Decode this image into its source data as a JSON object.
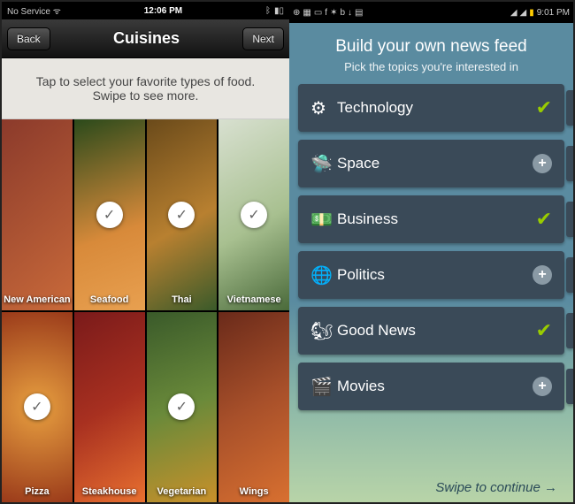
{
  "left": {
    "statusbar": {
      "carrier": "No Service",
      "time": "12:06 PM"
    },
    "header": {
      "back": "Back",
      "title": "Cuisines",
      "next": "Next"
    },
    "instructions": {
      "line1": "Tap to select your favorite types of food.",
      "line2": "Swipe to see more."
    },
    "tiles": [
      {
        "label": "New American",
        "selected": false
      },
      {
        "label": "Seafood",
        "selected": true
      },
      {
        "label": "Thai",
        "selected": true
      },
      {
        "label": "Vietnamese",
        "selected": true
      },
      {
        "label": "Pizza",
        "selected": true
      },
      {
        "label": "Steakhouse",
        "selected": false
      },
      {
        "label": "Vegetarian",
        "selected": true
      },
      {
        "label": "Wings",
        "selected": false
      }
    ]
  },
  "right": {
    "statusbar": {
      "time": "9:01 PM"
    },
    "header": {
      "title": "Build your own news feed",
      "subtitle": "Pick the topics you're interested in"
    },
    "topics": [
      {
        "icon": "gears",
        "label": "Technology",
        "selected": true
      },
      {
        "icon": "ufo",
        "label": "Space",
        "selected": false
      },
      {
        "icon": "money",
        "label": "Business",
        "selected": true
      },
      {
        "icon": "globe",
        "label": "Politics",
        "selected": false
      },
      {
        "icon": "animal",
        "label": "Good News",
        "selected": true
      },
      {
        "icon": "film",
        "label": "Movies",
        "selected": false
      }
    ],
    "swipe_hint": "Swipe to continue"
  }
}
